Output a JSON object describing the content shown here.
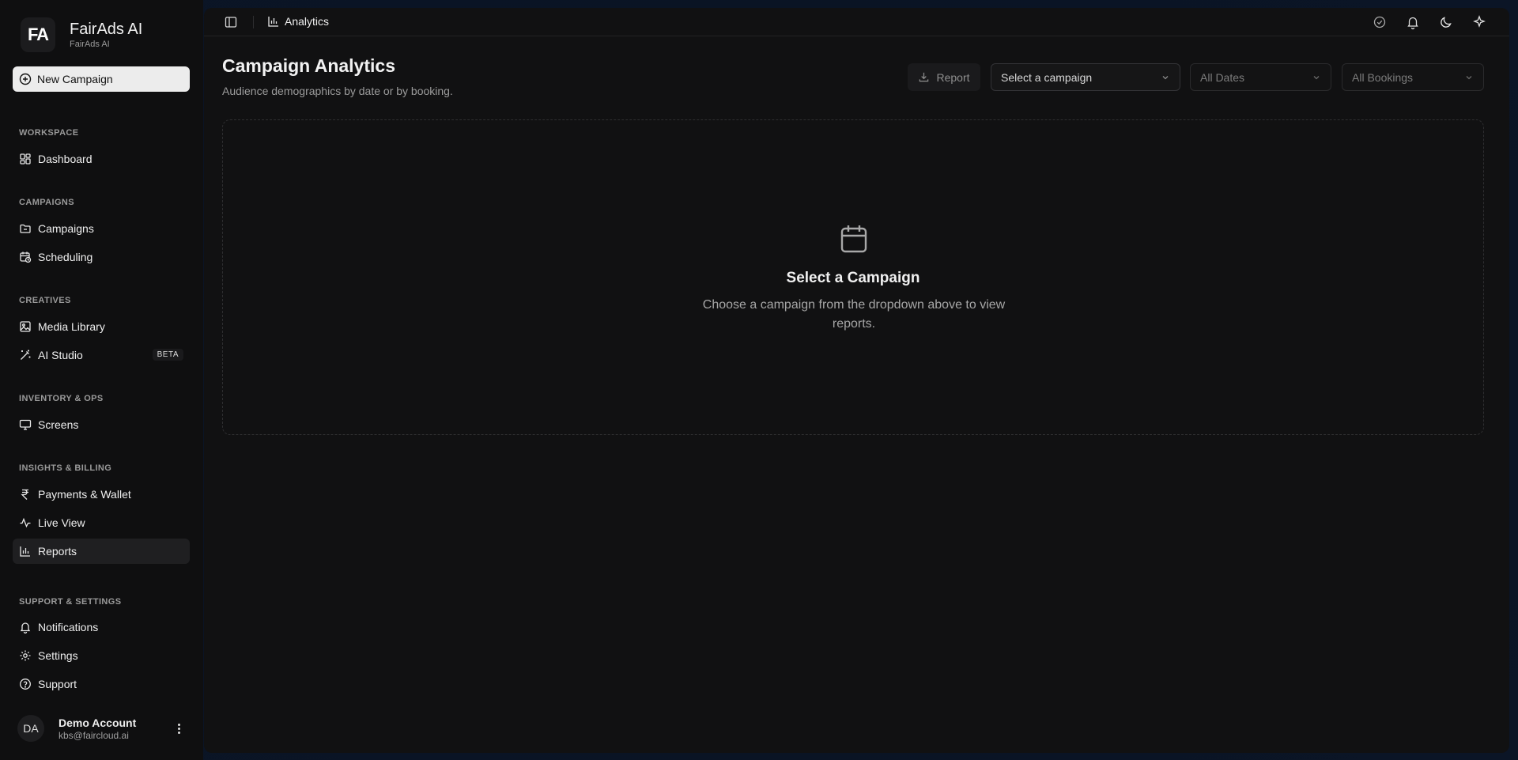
{
  "brand": {
    "logo_text": "FA",
    "name": "FairAds AI",
    "subtitle": "FairAds AI"
  },
  "sidebar": {
    "new_campaign_label": "New Campaign",
    "sections": [
      {
        "label": "WORKSPACE",
        "items": [
          {
            "label": "Dashboard",
            "icon": "dashboard-grid-icon"
          }
        ]
      },
      {
        "label": "CAMPAIGNS",
        "items": [
          {
            "label": "Campaigns",
            "icon": "folder-icon"
          },
          {
            "label": "Scheduling",
            "icon": "calendar-clock-icon"
          }
        ]
      },
      {
        "label": "CREATIVES",
        "items": [
          {
            "label": "Media Library",
            "icon": "image-icon"
          },
          {
            "label": "AI Studio",
            "icon": "magic-wand-icon",
            "badge": "BETA"
          }
        ]
      },
      {
        "label": "INVENTORY & OPS",
        "items": [
          {
            "label": "Screens",
            "icon": "monitor-icon"
          }
        ]
      },
      {
        "label": "INSIGHTS & BILLING",
        "items": [
          {
            "label": "Payments & Wallet",
            "icon": "rupee-icon"
          },
          {
            "label": "Live View",
            "icon": "activity-icon"
          },
          {
            "label": "Reports",
            "icon": "bar-chart-icon",
            "active": true
          }
        ]
      },
      {
        "label": "SUPPORT & SETTINGS",
        "items": [
          {
            "label": "Notifications",
            "icon": "bell-icon"
          },
          {
            "label": "Settings",
            "icon": "gear-icon"
          },
          {
            "label": "Support",
            "icon": "help-circle-icon"
          }
        ]
      }
    ]
  },
  "account": {
    "initials": "DA",
    "name": "Demo Account",
    "email": "kbs@faircloud.ai"
  },
  "topbar": {
    "breadcrumb": "Analytics"
  },
  "page": {
    "title": "Campaign Analytics",
    "subtitle": "Audience demographics by date or by booking.",
    "report_button": "Report",
    "campaign_select": "Select a campaign",
    "dates_select": "All Dates",
    "bookings_select": "All Bookings"
  },
  "empty_state": {
    "title": "Select a Campaign",
    "description": "Choose a campaign from the dropdown above to view reports."
  },
  "colors": {
    "background": "#111112",
    "sidebar": "#0f0f10",
    "accent": "#ececec"
  }
}
